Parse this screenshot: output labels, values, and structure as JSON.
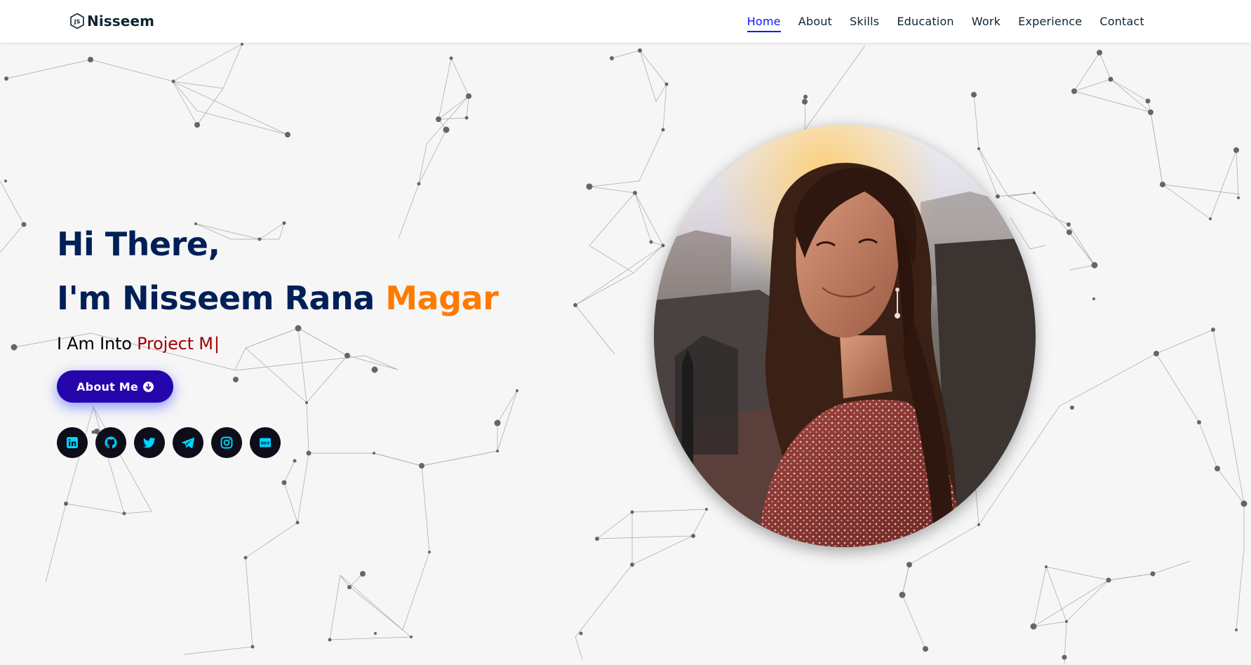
{
  "header": {
    "brand": "Nisseem",
    "logo_icon": "nodejs-hexagon-icon",
    "nav": [
      {
        "label": "Home",
        "active": true
      },
      {
        "label": "About",
        "active": false
      },
      {
        "label": "Skills",
        "active": false
      },
      {
        "label": "Education",
        "active": false
      },
      {
        "label": "Work",
        "active": false
      },
      {
        "label": "Experience",
        "active": false
      },
      {
        "label": "Contact",
        "active": false
      }
    ]
  },
  "hero": {
    "greeting": "Hi There,",
    "intro_prefix": "I'm Nisseem Rana",
    "intro_highlight": "Magar",
    "typing_prefix": "I Am Into",
    "typing_word": "Project M",
    "caret": "|",
    "button_label": "About Me",
    "button_icon": "arrow-down-circle-icon"
  },
  "socials": [
    {
      "name": "linkedin",
      "icon": "linkedin-icon"
    },
    {
      "name": "github",
      "icon": "github-icon"
    },
    {
      "name": "twitter",
      "icon": "twitter-icon"
    },
    {
      "name": "telegram",
      "icon": "telegram-icon"
    },
    {
      "name": "instagram",
      "icon": "instagram-icon"
    },
    {
      "name": "dev",
      "icon": "dev-icon",
      "label": "DEV"
    }
  ],
  "portrait": {
    "icon": "profile-photo"
  },
  "colors": {
    "navy": "#002057",
    "accent_orange": "#ff7b00",
    "typing_red": "#a00000",
    "button_blue": "#2506ad",
    "nav_active": "#011aff",
    "social_icon": "#00d4ff",
    "social_bg": "#0e0e1a",
    "background": "#f6f6f6"
  }
}
